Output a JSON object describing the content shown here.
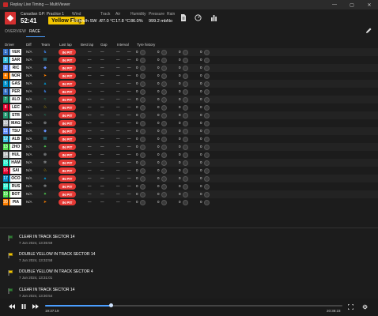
{
  "window": {
    "title": "Replay Live Timing — MultiViewer",
    "min": "—",
    "max": "▢",
    "close": "✕"
  },
  "header": {
    "session_label": "Canadian GP: Practice 1",
    "clock": "52:41",
    "flag_status": "Yellow Flag",
    "wind": {
      "label": "Wind",
      "value": "5.0 km/h SW ↗"
    },
    "track": {
      "label": "Track",
      "value": "27.0 °C"
    },
    "air": {
      "label": "Air",
      "value": "17.8 °C"
    },
    "humidity": {
      "label": "Humidity",
      "value": "86.0%"
    },
    "pressure": {
      "label": "Pressure",
      "value": "999.2 mb"
    },
    "rain": {
      "label": "Rain",
      "value": "No"
    }
  },
  "tabs": [
    {
      "label": "OVERVIEW"
    },
    {
      "label": "RACE"
    }
  ],
  "columns": {
    "driver": "Driver",
    "diff": "Diff",
    "team": "Team",
    "last_lap": "Last lap",
    "best_lap": "Best lap",
    "gap": "Gap",
    "interval": "Interval",
    "tyre_history": "Tyre history"
  },
  "drivers": [
    {
      "pos": "1",
      "code": "VER",
      "pos_color": "#3671C6",
      "diff": "N/A",
      "team_glyph": "♞",
      "team_color": "#3671C6",
      "status": "IN PIT"
    },
    {
      "pos": "2",
      "code": "SAR",
      "pos_color": "#37BEDD",
      "diff": "N/A",
      "team_glyph": "W",
      "team_color": "#37BEDD",
      "status": "IN PIT"
    },
    {
      "pos": "3",
      "code": "RIC",
      "pos_color": "#6692FF",
      "diff": "N/A",
      "team_glyph": "◆",
      "team_color": "#6692FF",
      "status": "IN PIT"
    },
    {
      "pos": "4",
      "code": "NOR",
      "pos_color": "#FF8000",
      "diff": "N/A",
      "team_glyph": "➤",
      "team_color": "#FF8000",
      "status": "IN PIT"
    },
    {
      "pos": "5",
      "code": "GAS",
      "pos_color": "#0093CC",
      "diff": "N/A",
      "team_glyph": "▲",
      "team_color": "#0093CC",
      "status": "IN PIT"
    },
    {
      "pos": "6",
      "code": "PER",
      "pos_color": "#3671C6",
      "diff": "N/A",
      "team_glyph": "♞",
      "team_color": "#3671C6",
      "status": "IN PIT"
    },
    {
      "pos": "7",
      "code": "ALO",
      "pos_color": "#229971",
      "diff": "N/A",
      "team_glyph": "≈",
      "team_color": "#229971",
      "status": "IN PIT"
    },
    {
      "pos": "8",
      "code": "LEC",
      "pos_color": "#E8002D",
      "diff": "N/A",
      "team_glyph": "♘",
      "team_color": "#F2C500",
      "status": "IN PIT"
    },
    {
      "pos": "9",
      "code": "STR",
      "pos_color": "#229971",
      "diff": "N/A",
      "team_glyph": "≈",
      "team_color": "#229971",
      "status": "IN PIT"
    },
    {
      "pos": "10",
      "code": "MAG",
      "pos_color": "#B6BABD",
      "diff": "N/A",
      "team_glyph": "⊛",
      "team_color": "#B6BABD",
      "status": "IN PIT"
    },
    {
      "pos": "11",
      "code": "TSU",
      "pos_color": "#6692FF",
      "diff": "N/A",
      "team_glyph": "◆",
      "team_color": "#6692FF",
      "status": "IN PIT"
    },
    {
      "pos": "12",
      "code": "ALB",
      "pos_color": "#37BEDD",
      "diff": "N/A",
      "team_glyph": "W",
      "team_color": "#37BEDD",
      "status": "IN PIT"
    },
    {
      "pos": "13",
      "code": "ZHO",
      "pos_color": "#52E252",
      "diff": "N/A",
      "team_glyph": "✦",
      "team_color": "#52E252",
      "status": "IN PIT"
    },
    {
      "pos": "14",
      "code": "HUL",
      "pos_color": "#B6BABD",
      "diff": "N/A",
      "team_glyph": "⊛",
      "team_color": "#B6BABD",
      "status": "IN PIT"
    },
    {
      "pos": "15",
      "code": "HAM",
      "pos_color": "#27F4D2",
      "diff": "N/A",
      "team_glyph": "✲",
      "team_color": "#B6BABD",
      "status": "IN PIT"
    },
    {
      "pos": "16",
      "code": "SAI",
      "pos_color": "#E8002D",
      "diff": "N/A",
      "team_glyph": "♘",
      "team_color": "#F2C500",
      "status": "IN PIT"
    },
    {
      "pos": "17",
      "code": "OCO",
      "pos_color": "#0093CC",
      "diff": "N/A",
      "team_glyph": "▲",
      "team_color": "#0093CC",
      "status": "IN PIT"
    },
    {
      "pos": "18",
      "code": "RUS",
      "pos_color": "#27F4D2",
      "diff": "N/A",
      "team_glyph": "✲",
      "team_color": "#B6BABD",
      "status": "IN PIT"
    },
    {
      "pos": "19",
      "code": "BOT",
      "pos_color": "#52E252",
      "diff": "N/A",
      "team_glyph": "✦",
      "team_color": "#52E252",
      "status": "IN PIT"
    },
    {
      "pos": "20",
      "code": "PIA",
      "pos_color": "#FF8000",
      "diff": "N/A",
      "team_glyph": "➤",
      "team_color": "#FF8000",
      "status": "IN PIT"
    }
  ],
  "placeholders": {
    "last_lap": "—",
    "best_lap": "—",
    "gap": "—",
    "interval": "—",
    "tyre_count": "0"
  },
  "race_control": [
    {
      "message": "CLEAR IN TRACK SECTOR 14",
      "time": "7 Jun 2024, 13:35:59",
      "flag": "green"
    },
    {
      "message": "DOUBLE YELLOW IN TRACK SECTOR 14",
      "time": "7 Jun 2024, 13:32:58",
      "flag": "yellow"
    },
    {
      "message": "DOUBLE YELLOW IN TRACK SECTOR 4",
      "time": "7 Jun 2024, 13:31:01",
      "flag": "yellow"
    },
    {
      "message": "CLEAR IN TRACK SECTOR 14",
      "time": "7 Jun 2024, 13:30:54",
      "flag": "green"
    }
  ],
  "player": {
    "current_time": "19:37:19",
    "end_time": "20:38:23",
    "progress": 0.22
  },
  "colors": {
    "accent": "#4a9eff",
    "pit": "#e53935",
    "yellow": "#f2c500",
    "green_flag": "#2e7d32"
  }
}
